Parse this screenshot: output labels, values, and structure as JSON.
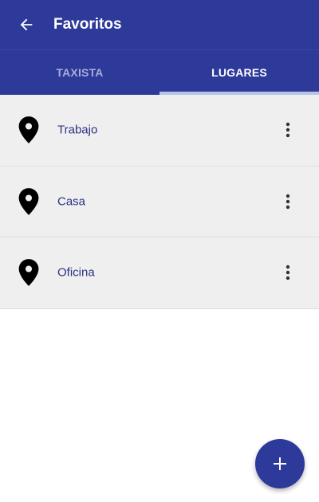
{
  "colors": {
    "primary": "#2e3a9a",
    "indicator": "#b6c4e6",
    "list_background": "#efefef",
    "item_text": "#2b3385"
  },
  "appbar": {
    "back_icon": "arrow-left-icon",
    "title": "Favoritos"
  },
  "tabs": [
    {
      "label": "TAXISTA",
      "active": false
    },
    {
      "label": "LUGARES",
      "active": true
    }
  ],
  "places": [
    {
      "label": "Trabajo",
      "icon": "map-pin-icon",
      "menu_icon": "more-vert-icon"
    },
    {
      "label": "Casa",
      "icon": "map-pin-icon",
      "menu_icon": "more-vert-icon"
    },
    {
      "label": "Oficina",
      "icon": "map-pin-icon",
      "menu_icon": "more-vert-icon"
    }
  ],
  "fab": {
    "icon": "plus-icon"
  }
}
